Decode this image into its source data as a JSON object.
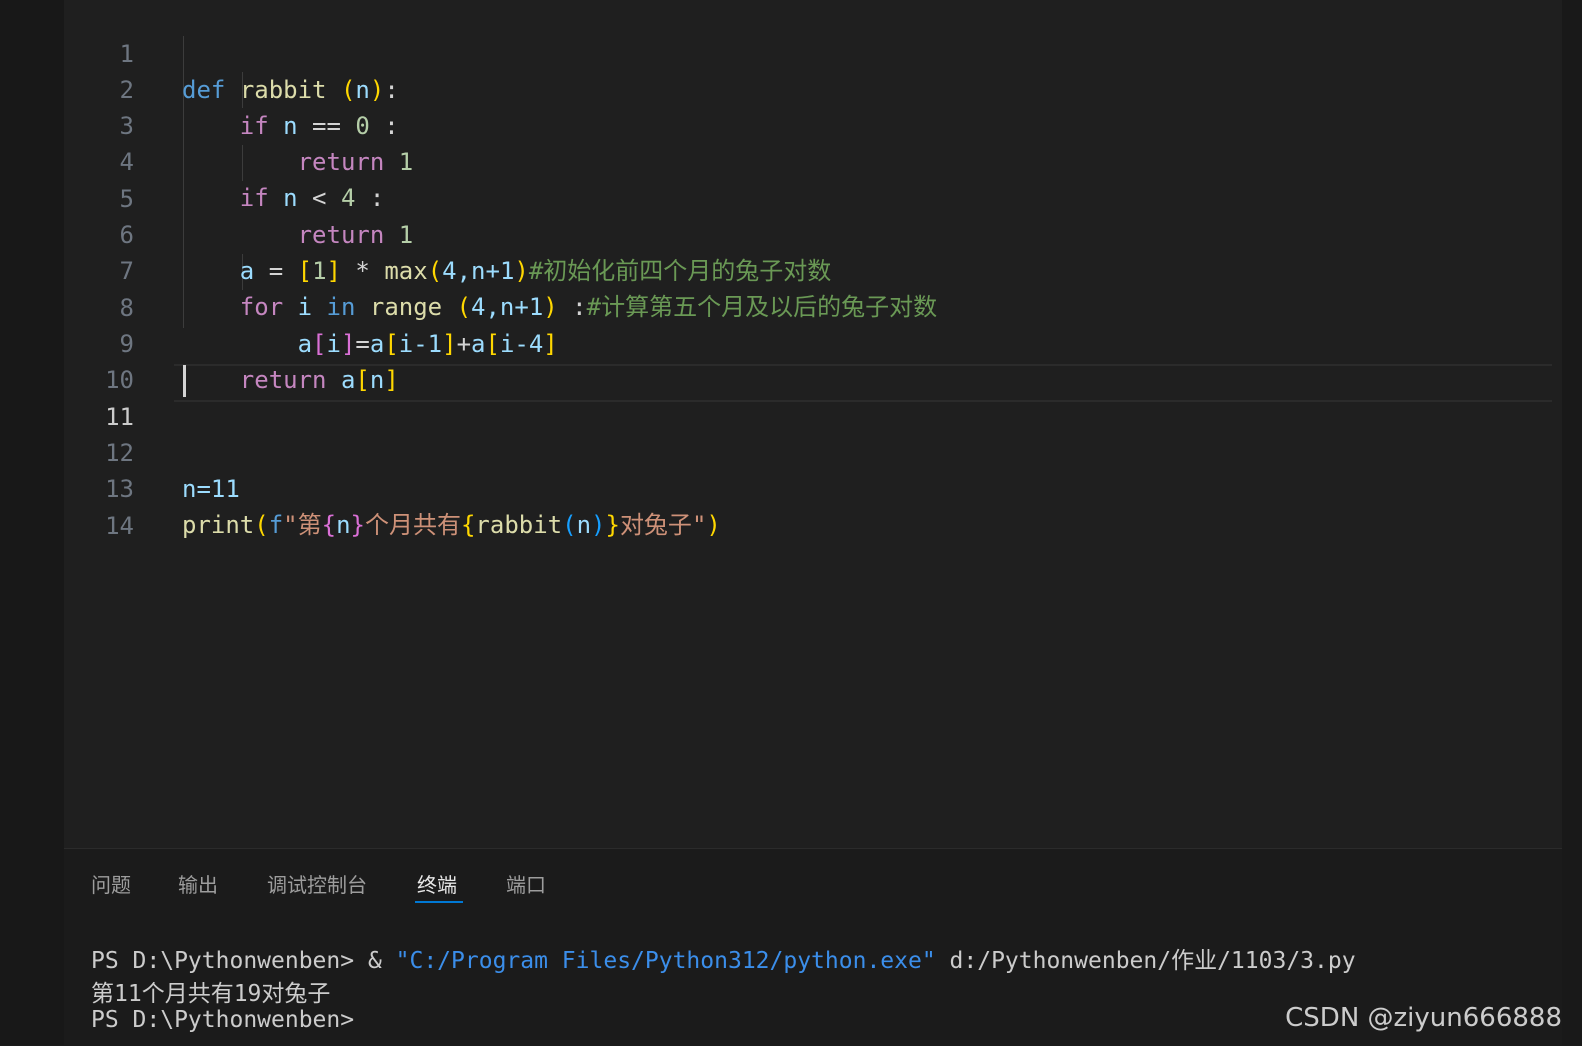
{
  "editor": {
    "line_numbers": [
      "1",
      "2",
      "3",
      "4",
      "5",
      "6",
      "7",
      "8",
      "9",
      "10",
      "11",
      "12",
      "13",
      "14"
    ],
    "active_line": "11",
    "code": {
      "l1": {
        "def": "def",
        "name": "rabbit",
        "sp": " ",
        "p_open": "(",
        "arg": "n",
        "p_close": ")",
        "colon": ":"
      },
      "l2": {
        "kw": "if",
        "var": "n",
        "op": " == ",
        "num": "0",
        "colon": " :"
      },
      "l3": {
        "kw": "return",
        "num": "1"
      },
      "l4": {
        "kw": "if",
        "var": "n",
        "op": " < ",
        "num": "4",
        "colon": " :"
      },
      "l5": {
        "kw": "return",
        "num": "1"
      },
      "l6": {
        "var": "a",
        "op": " = ",
        "b_open": "[",
        "num1": "1",
        "b_close": "]",
        "op2": " * ",
        "fn": "max",
        "p_open": "(",
        "args": "4,n+1",
        "p_close": ")",
        "comment": "#初始化前四个月的兔子对数"
      },
      "l7": {
        "kw": "for",
        "var": "i",
        "kw_in": "in",
        "fn": "range",
        "p_open": "(",
        "args": "4,n+1",
        "p_close": ")",
        "colon": " :",
        "comment": "#计算第五个月及以后的兔子对数"
      },
      "l8": {
        "a1": "a",
        "bo1": "[",
        "i1": "i",
        "bc1": "]",
        "eq": "=",
        "a2": "a",
        "bo2": "[",
        "i2": "i-1",
        "bc2": "]",
        "plus": "+",
        "a3": "a",
        "bo3": "[",
        "i3": "i-4",
        "bc3": "]"
      },
      "l9": {
        "kw": "return",
        "var": "a",
        "b_open": "[",
        "idx": "n",
        "b_close": "]"
      },
      "l12": {
        "text": "n=11"
      },
      "l13": {
        "fn": "print",
        "p_open": "(",
        "f": "f",
        "q": "\"",
        "s1": "第",
        "c1o": "{",
        "v1": "n",
        "c1c": "}",
        "s2": "个月共有",
        "c2o": "{",
        "fn2": "rabbit",
        "p2o": "(",
        "v2": "n",
        "p2c": ")",
        "c2c": "}",
        "s3": "对兔子",
        "q2": "\"",
        "p_close": ")"
      }
    }
  },
  "panel": {
    "tabs": [
      "问题",
      "输出",
      "调试控制台",
      "终端",
      "端口"
    ],
    "active_tab": "终端",
    "terminal": {
      "line1_prompt": "PS D:\\Pythonwenben> & ",
      "line1_exe": "\"C:/Program Files/Python312/python.exe\"",
      "line1_script": " d:/Pythonwenben/作业/1103/3.py",
      "line2": "第11个月共有19对兔子",
      "line3": "PS D:\\Pythonwenben>"
    }
  },
  "watermark": "CSDN @ziyun666888",
  "colors": {
    "keyword_blue": "#569cd6",
    "keyword_purple": "#c586c0",
    "function": "#dcdcaa",
    "variable": "#9cdcfe",
    "number": "#b5cea8",
    "comment": "#6a9955",
    "string": "#ce9178",
    "accent": "#0078d4"
  }
}
